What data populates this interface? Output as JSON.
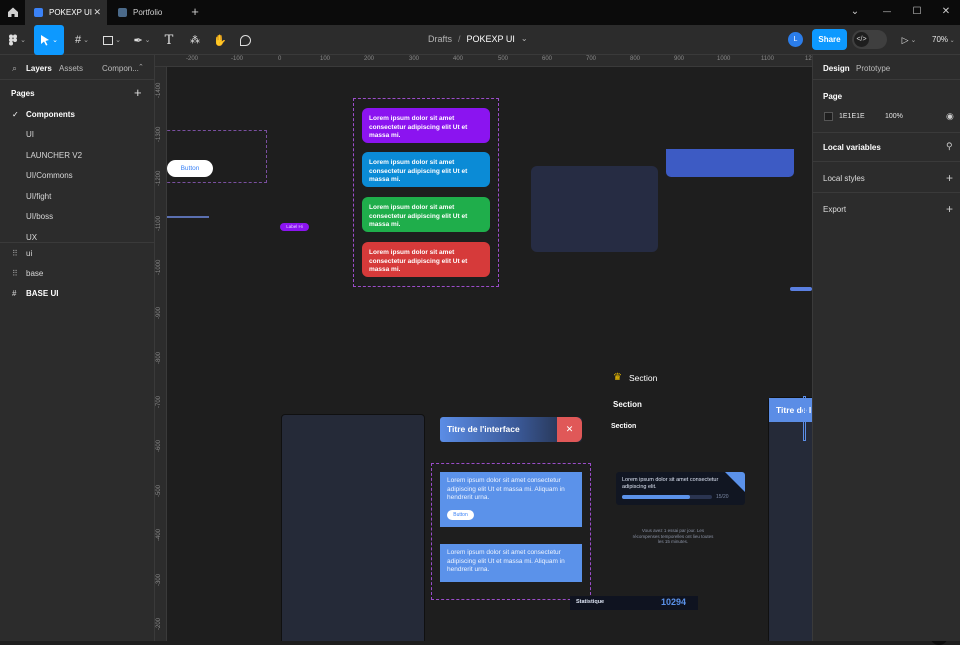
{
  "tabs": {
    "active_label": "POKEXP UI",
    "second_label": "Portfolio",
    "new_tab": "+"
  },
  "window": {
    "chevron": "⌄",
    "minimize": "—",
    "maximize": "☐",
    "close": "✕"
  },
  "toolbar": {
    "breadcrumb_parent": "Drafts",
    "breadcrumb_sep": "/",
    "file_name": "POKEXP UI",
    "avatar_letter": "L",
    "share_label": "Share",
    "zoom": "70%"
  },
  "left_panel": {
    "tab_layers": "Layers",
    "tab_assets": "Assets",
    "tab_components": "Compon...",
    "pages_label": "Pages",
    "add": "+",
    "pages": [
      "Components",
      "UI",
      "LAUNCHER V2",
      "UI/Commons",
      "UI/fight",
      "UI/boss",
      "UX"
    ],
    "layers": [
      {
        "icon": "⠿",
        "name": "ui"
      },
      {
        "icon": "⠿",
        "name": "base"
      },
      {
        "icon": "#",
        "name": "BASE UI"
      }
    ]
  },
  "ruler": {
    "top": [
      "-200",
      "-100",
      "0",
      "100",
      "200",
      "300",
      "400",
      "500",
      "600",
      "700",
      "800",
      "900",
      "1000",
      "1100",
      "12"
    ],
    "left": [
      "-1400",
      "-1300",
      "-1200",
      "-1100",
      "-1000",
      "-900",
      "-800",
      "-700",
      "-600",
      "-500",
      "-400",
      "-300",
      "-200"
    ]
  },
  "canvas": {
    "button_label": "Button",
    "small_badge": "Label Hi",
    "toasts": [
      {
        "text": "Lorem ipsum dolor sit amet consectetur adipiscing elit Ut et massa mi.",
        "color": "#8b14f0"
      },
      {
        "text": "Lorem ipsum dolor sit amet consectetur adipiscing elit Ut et massa mi.",
        "color": "#0b8bd6"
      },
      {
        "text": "Lorem ipsum dolor sit amet consectetur adipiscing elit Ut et massa mi.",
        "color": "#1fae4b"
      },
      {
        "text": "Lorem ipsum dolor sit amet consectetur adipiscing elit Ut et massa mi.",
        "color": "#d63a3a"
      }
    ],
    "sections": [
      "Section",
      "Section",
      "Section"
    ],
    "crown_icon": "♛",
    "interface_title": "Titre de l'interface",
    "close_x": "✕",
    "card1_text": "Lorem ipsum dolor sit amet consectetur adipiscing elit Ut et massa mi. Aliquam in hendrerit urna.",
    "card1_button": "Button",
    "card2_text": "Lorem ipsum dolor sit amet consectetur adipiscing elit Ut et massa mi. Aliquam in hendrerit urna.",
    "progress_text": "Lorem ipsum dolor sit amet consectetur adipiscing elit.",
    "progress_value": "15/20",
    "progress_fraction": 0.75,
    "small_note": "Vous avez 1 essai par jour. Les récompenses temporelles ont lieu toutes les 15 minutes.",
    "stat_label": "Statistique",
    "stat_value": "10294",
    "right_title": "Titre de l"
  },
  "right_panel": {
    "tab_design": "Design",
    "tab_prototype": "Prototype",
    "page_label": "Page",
    "page_color": "1E1E1E",
    "page_opacity": "100%",
    "local_variables": "Local variables",
    "local_styles": "Local styles",
    "export": "Export"
  },
  "colors": {
    "accent": "#0d99ff",
    "toolbar": "#2c2c2c",
    "canvas": "#1e1e1e"
  }
}
